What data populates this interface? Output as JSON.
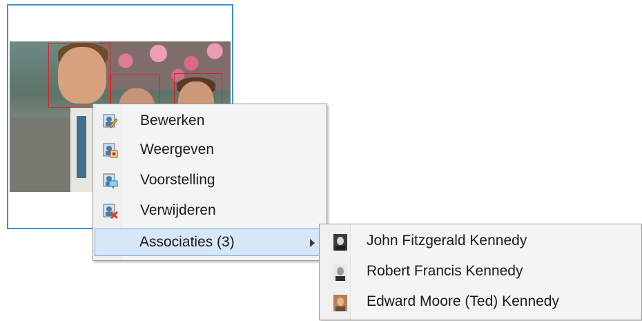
{
  "context_menu": {
    "items": [
      {
        "label": "Bewerken",
        "icon": "edit-person-icon"
      },
      {
        "label": "Weergeven",
        "icon": "view-person-icon"
      },
      {
        "label": "Voorstelling",
        "icon": "present-person-icon"
      },
      {
        "label": "Verwijderen",
        "icon": "delete-person-icon"
      },
      {
        "label": "Associaties (3)",
        "icon": "chevron-right-icon"
      }
    ]
  },
  "submenu": {
    "items": [
      {
        "label": "John Fitzgerald Kennedy"
      },
      {
        "label": "Robert Francis Kennedy"
      },
      {
        "label": "Edward Moore (Ted) Kennedy"
      }
    ]
  },
  "colors": {
    "selection_border": "#3d8fd6",
    "face_box": "#e0201e",
    "menu_highlight": "#d8e7f8"
  }
}
